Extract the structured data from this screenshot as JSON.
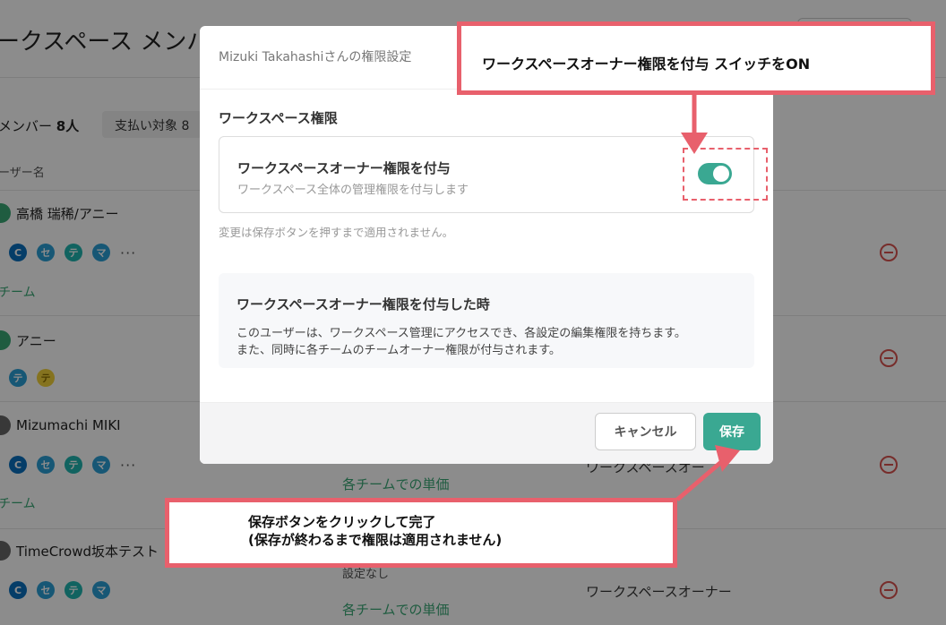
{
  "background": {
    "title": "ークスペース メンバ",
    "member_label": "メンバー",
    "member_count": "8人",
    "billing_pill": "支払い対象 8",
    "column_header": "ーザー名",
    "rows": [
      {
        "name": "高橋 瑞稀/アニー",
        "icons": [
          "C",
          "セ",
          "テ",
          "マ"
        ],
        "team_link": "チーム",
        "price": "",
        "role": "",
        "setting": ""
      },
      {
        "name": "アニー",
        "icons": [
          "テ",
          "テ"
        ],
        "team_link": "",
        "price": "",
        "role": "",
        "setting": ""
      },
      {
        "name": "Mizumachi MIKI",
        "icons": [
          "C",
          "セ",
          "テ",
          "マ"
        ],
        "team_link": "チーム",
        "price": "各チームでの単価",
        "role": "ワークスペースオー",
        "setting": ""
      },
      {
        "name": "TimeCrowd坂本テスト",
        "icons": [
          "C",
          "セ",
          "テ",
          "マ"
        ],
        "team_link": "",
        "price": "各チームでの単価",
        "role": "ワークスペースオーナー",
        "setting": "設定なし"
      }
    ],
    "more_glyph": "···"
  },
  "modal": {
    "title": "Mizuki Takahashiさんの権限設定",
    "section_title": "ワークスペース権限",
    "permission": {
      "label": "ワークスペースオーナー権限を付与",
      "description": "ワークスペース全体の管理権限を付与します",
      "enabled": true
    },
    "note": "変更は保存ボタンを押すまで適用されません。",
    "info": {
      "title": "ワークスペースオーナー権限を付与した時",
      "line1": "このユーザーは、ワークスペース管理にアクセスでき、各設定の編集権限を持ちます。",
      "line2": "また、同時に各チームのチームオーナー権限が付与されます。"
    },
    "cancel_label": "キャンセル",
    "save_label": "保存"
  },
  "callouts": {
    "top": "ワークスペースオーナー権限を付与 スイッチをON",
    "bottom_line1": "保存ボタンをクリックして完了",
    "bottom_line2": "(保存が終わるまで権限は適用されません)"
  },
  "colors": {
    "accent": "#3aa892",
    "callout_border": "#e8606c",
    "danger": "#d9534f"
  }
}
